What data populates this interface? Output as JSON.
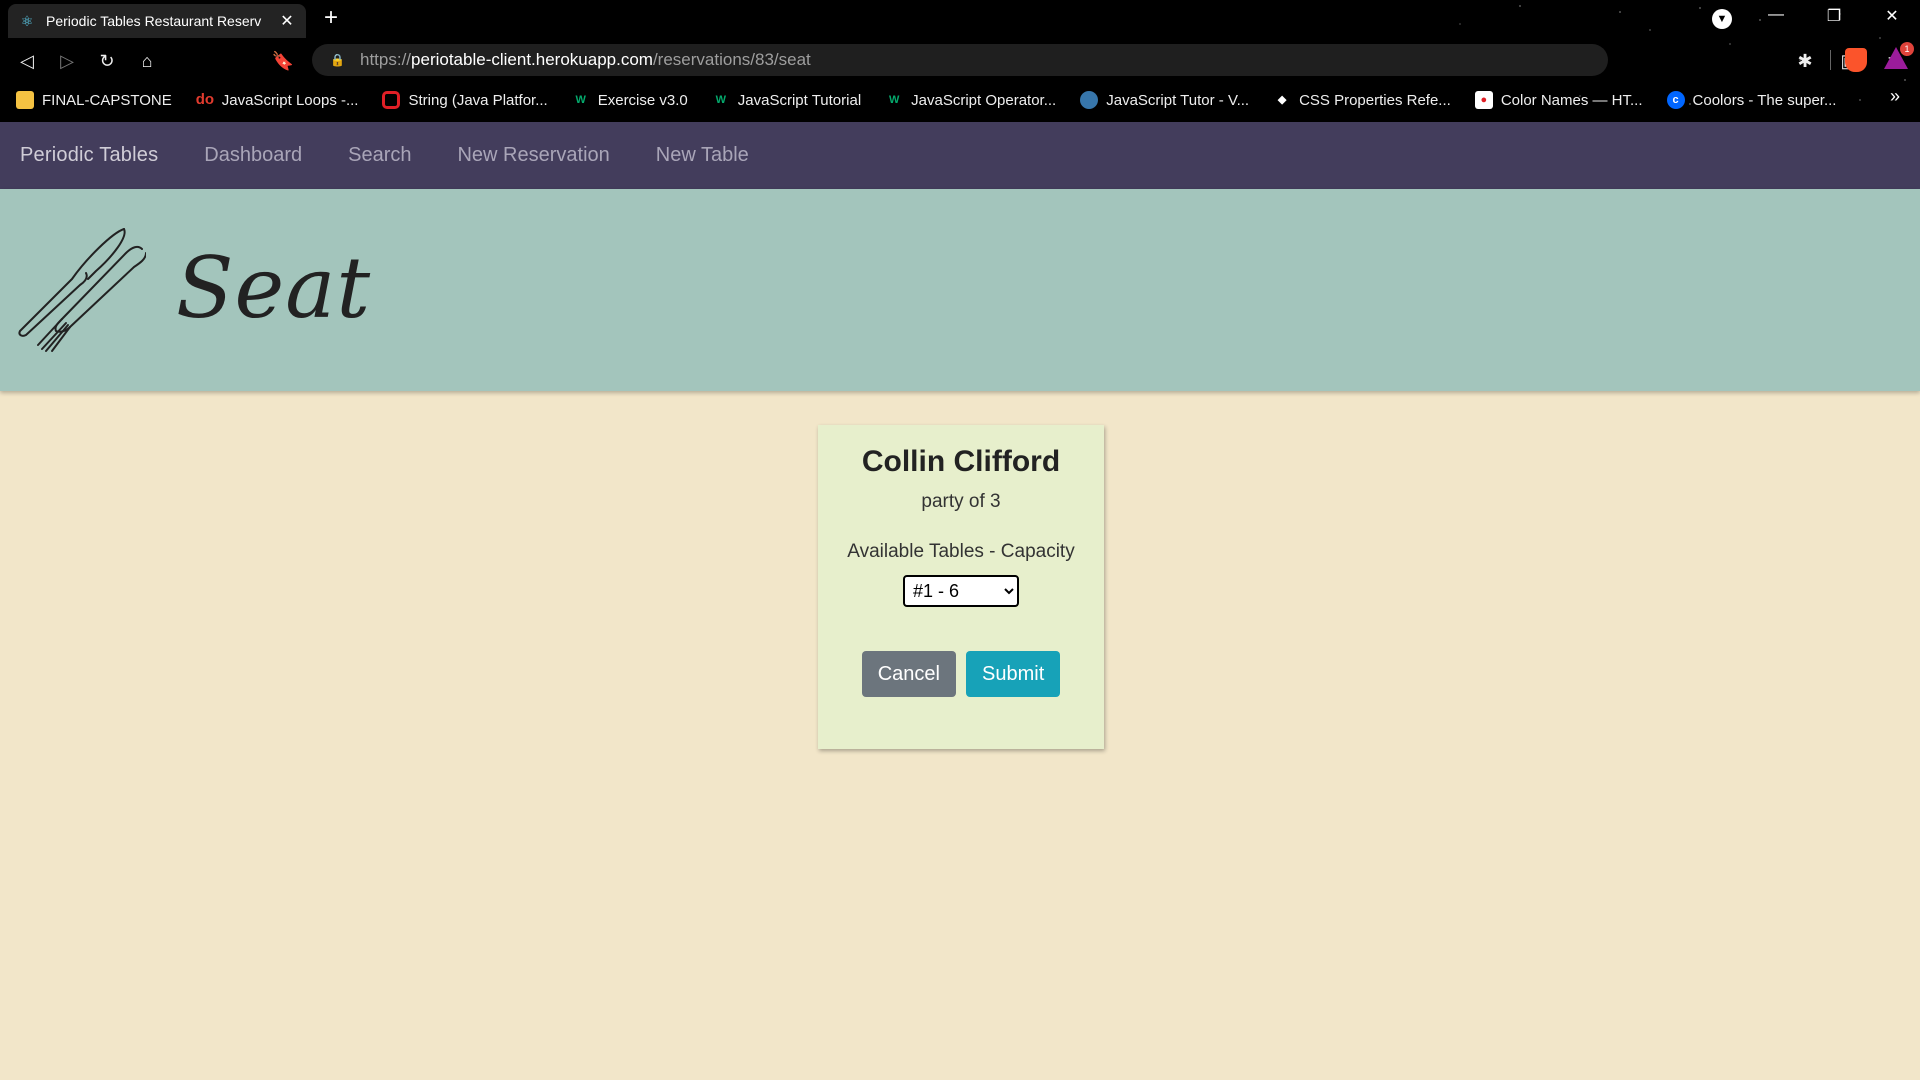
{
  "browser": {
    "tab_title": "Periodic Tables Restaurant Reserv",
    "tab_close": "✕",
    "new_tab": "+",
    "url_scheme": "https://",
    "url_host": "periotable-client.herokuapp.com",
    "url_path": "/reservations/83/seat",
    "rewards_badge": "1",
    "bookmarks": [
      {
        "label": "FINAL-CAPSTONE",
        "icon": "folder-icon",
        "color": "#f5c242"
      },
      {
        "label": "JavaScript Loops -...",
        "icon": "do-icon",
        "color": "#e23b2e"
      },
      {
        "label": "String (Java Platfor...",
        "icon": "oracle-icon",
        "color": "#e01f26"
      },
      {
        "label": "Exercise v3.0",
        "icon": "w3-icon",
        "color": "#04aa6d"
      },
      {
        "label": "JavaScript Tutorial",
        "icon": "w3-icon",
        "color": "#04aa6d"
      },
      {
        "label": "JavaScript Operator...",
        "icon": "w3-icon",
        "color": "#04aa6d"
      },
      {
        "label": "JavaScript Tutor - V...",
        "icon": "python-icon",
        "color": "#3776ab"
      },
      {
        "label": "CSS Properties Refe...",
        "icon": "css-icon",
        "color": "#ffffff"
      },
      {
        "label": "Color Names — HT...",
        "icon": "color-icon",
        "color": "#e01f26"
      },
      {
        "label": "Coolors - The super...",
        "icon": "coolors-icon",
        "color": "#0066ff"
      }
    ],
    "bookmarks_more": "»"
  },
  "navbar": {
    "brand": "Periodic Tables",
    "links": [
      "Dashboard",
      "Search",
      "New Reservation",
      "New Table"
    ]
  },
  "header": {
    "title": "Seat"
  },
  "card": {
    "guest_name": "Collin Clifford",
    "party": "party of 3",
    "tables_label": "Available Tables - Capacity",
    "selected_table": "#1 - 6",
    "cancel_label": "Cancel",
    "submit_label": "Submit"
  },
  "colors": {
    "navbar": "#433d5c",
    "header_band": "#a3c5bc",
    "page_bg": "#f2e6c9",
    "card_bg": "#e7efcc",
    "cancel": "#6c757d",
    "submit": "#17a2b8"
  }
}
